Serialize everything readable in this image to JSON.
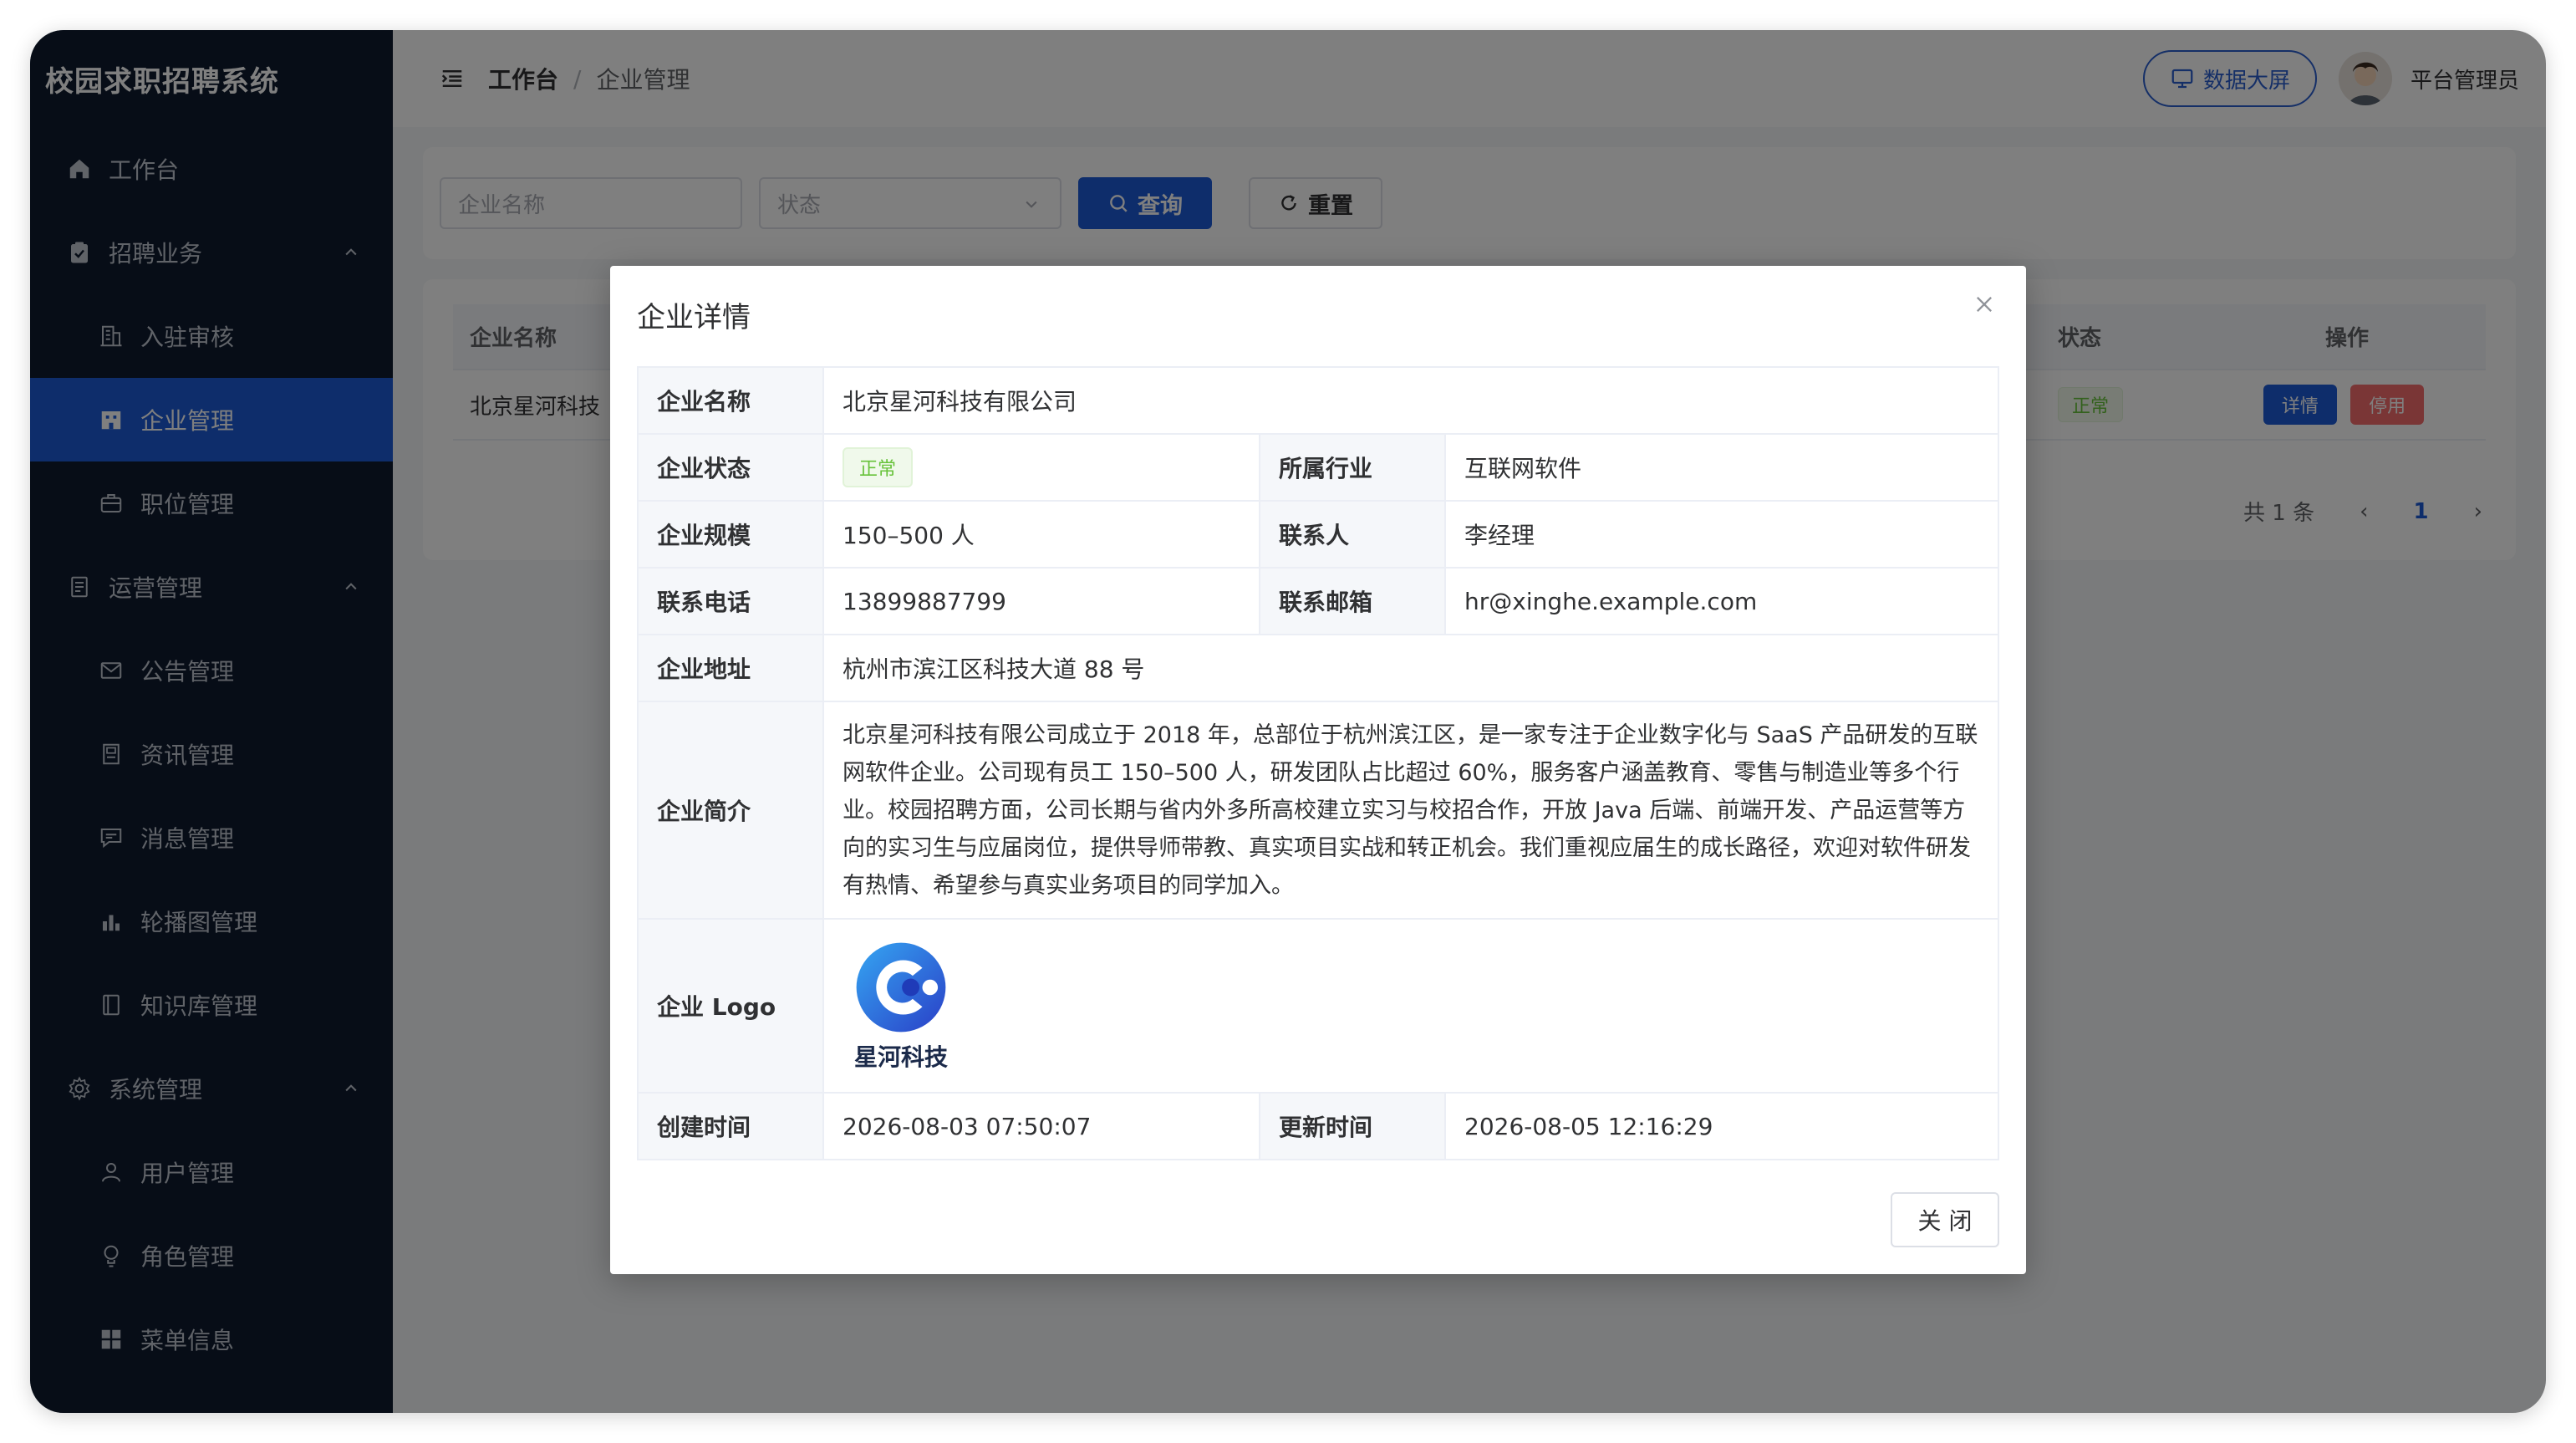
{
  "app": {
    "title": "校园求职招聘系统"
  },
  "sidebar": {
    "items": [
      {
        "label": "工作台",
        "icon": "home-icon",
        "level": 1
      },
      {
        "label": "招聘业务",
        "icon": "clipboard-check-icon",
        "level": 1,
        "expanded": true
      },
      {
        "label": "入驻审核",
        "icon": "building-icon",
        "level": 2
      },
      {
        "label": "企业管理",
        "icon": "office-icon",
        "level": 2,
        "active": true
      },
      {
        "label": "职位管理",
        "icon": "briefcase-icon",
        "level": 2
      },
      {
        "label": "运营管理",
        "icon": "document-icon",
        "level": 1,
        "expanded": true
      },
      {
        "label": "公告管理",
        "icon": "mail-icon",
        "level": 2
      },
      {
        "label": "资讯管理",
        "icon": "news-icon",
        "level": 2
      },
      {
        "label": "消息管理",
        "icon": "message-icon",
        "level": 2
      },
      {
        "label": "轮播图管理",
        "icon": "bar-chart-icon",
        "level": 2
      },
      {
        "label": "知识库管理",
        "icon": "book-icon",
        "level": 2
      },
      {
        "label": "系统管理",
        "icon": "gear-icon",
        "level": 1,
        "expanded": true
      },
      {
        "label": "用户管理",
        "icon": "user-icon",
        "level": 2
      },
      {
        "label": "角色管理",
        "icon": "lightbulb-icon",
        "level": 2
      },
      {
        "label": "菜单信息",
        "icon": "grid-icon",
        "level": 2
      }
    ]
  },
  "header": {
    "breadcrumb_home": "工作台",
    "breadcrumb_sep": "/",
    "breadcrumb_current": "企业管理",
    "data_screen_label": "数据大屏",
    "username": "平台管理员"
  },
  "search": {
    "name_placeholder": "企业名称",
    "status_placeholder": "状态",
    "query_label": "查询",
    "reset_label": "重置"
  },
  "table": {
    "headers": [
      "企业名称",
      "状态",
      "操作"
    ],
    "rows": [
      {
        "name": "北京星河科技",
        "status": "正常",
        "detail": "详情",
        "disable": "停用"
      }
    ],
    "pagination": {
      "total": "共 1 条",
      "current": "1"
    }
  },
  "dialog": {
    "title": "企业详情",
    "labels": {
      "name": "企业名称",
      "status": "企业状态",
      "industry": "所属行业",
      "scale": "企业规模",
      "contact": "联系人",
      "phone": "联系电话",
      "email": "联系邮箱",
      "address": "企业地址",
      "intro": "企业简介",
      "logo": "企业 Logo",
      "created": "创建时间",
      "updated": "更新时间"
    },
    "values": {
      "name": "北京星河科技有限公司",
      "status": "正常",
      "industry": "互联网软件",
      "scale": "150–500 人",
      "contact": "李经理",
      "phone": "13899887799",
      "email": "hr@xinghe.example.com",
      "address": "杭州市滨江区科技大道 88 号",
      "intro": "北京星河科技有限公司成立于 2018 年，总部位于杭州滨江区，是一家专注于企业数字化与 SaaS 产品研发的互联网软件企业。公司现有员工 150–500 人，研发团队占比超过 60%，服务客户涵盖教育、零售与制造业等多个行业。校园招聘方面，公司长期与省内外多所高校建立实习与校招合作，开放 Java 后端、前端开发、产品运营等方向的实习生与应届岗位，提供导师带教、真实项目实战和转正机会。我们重视应届生的成长路径，欢迎对软件研发有热情、希望参与真实业务项目的同学加入。",
      "logo_text": "星河科技",
      "created": "2026-08-03 07:50:07",
      "updated": "2026-08-05 12:16:29"
    },
    "close_label": "关 闭"
  },
  "colors": {
    "sidebar_bg": "#0e1a2f",
    "primary": "#1d5bd6",
    "success": "#67c23a",
    "danger": "#f56c6c"
  }
}
